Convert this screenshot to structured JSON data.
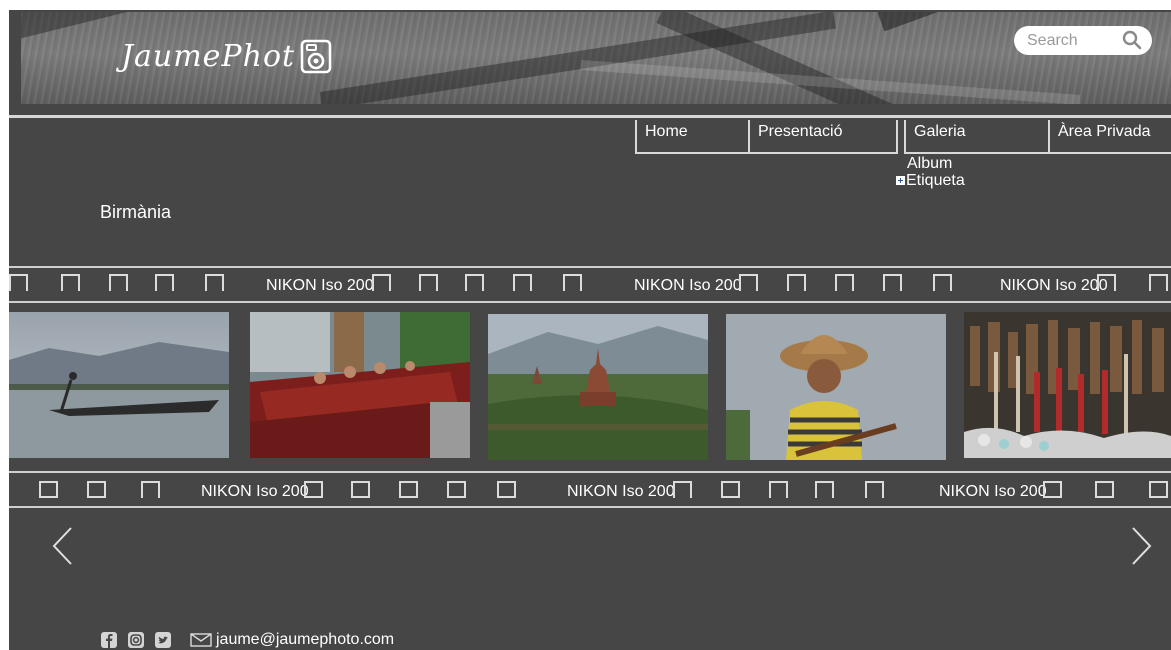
{
  "brand": {
    "logo_text": "JaumePhot"
  },
  "search": {
    "placeholder": "Search"
  },
  "nav": {
    "items": [
      "Home",
      "Presentació",
      "Galeria",
      "Àrea Privada"
    ]
  },
  "submenu": {
    "items": [
      "Album",
      "Etiqueta"
    ]
  },
  "page": {
    "title": "Birmània"
  },
  "filmstrip": {
    "label": "NIKON Iso 200"
  },
  "photos": [
    {
      "subject": "Leg rower on lake"
    },
    {
      "subject": "Monks procession"
    },
    {
      "subject": "Temple landscape"
    },
    {
      "subject": "Girl with straw hat"
    },
    {
      "subject": "Market crafts"
    }
  ],
  "footer": {
    "email": "jaume@jaumephoto.com"
  },
  "icons": {
    "search": "search-icon",
    "camera": "camera-icon",
    "prev": "chevron-left-icon",
    "next": "chevron-right-icon",
    "facebook": "facebook-icon",
    "instagram": "instagram-icon",
    "twitter": "twitter-icon",
    "mail": "mail-icon"
  },
  "colors": {
    "background": "#464646",
    "text": "#ffffff",
    "rail": "#cfcfcf",
    "page_edge": "#ffffff"
  }
}
